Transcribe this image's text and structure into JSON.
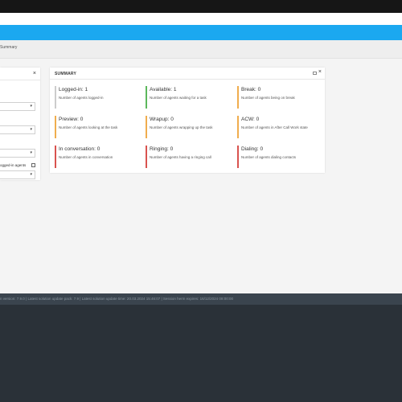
{
  "breadcrumb": {
    "current": "Summary"
  },
  "filter_panel": {
    "close_label": "×",
    "checkbox_label": "ogged-in agents"
  },
  "summary": {
    "title": "SUMMARY",
    "close_label": "×",
    "cards": [
      {
        "label": "Logged-in:",
        "value": "1",
        "description": "Number of agents logged-in",
        "color": "#cccccc"
      },
      {
        "label": "Available:",
        "value": "1",
        "description": "Number of agents waiting for a task",
        "color": "#5cb85c"
      },
      {
        "label": "Break:",
        "value": "0",
        "description": "Number of agents being on break",
        "color": "#f0ad4e"
      },
      {
        "label": "Preview:",
        "value": "0",
        "description": "Number of agents looking at the task",
        "color": "#f0ad4e"
      },
      {
        "label": "Wrapup:",
        "value": "0",
        "description": "Number of agents wrapping up the task",
        "color": "#f0ad4e"
      },
      {
        "label": "ACW:",
        "value": "0",
        "description": "Number of agents in After Call Work state",
        "color": "#f0ad4e"
      },
      {
        "label": "In conversation:",
        "value": "0",
        "description": "Number of agents in conversation",
        "color": "#d9534f"
      },
      {
        "label": "Ringing:",
        "value": "0",
        "description": "Number of agents having a ringing call",
        "color": "#d9534f"
      },
      {
        "label": "Dialing:",
        "value": "0",
        "description": "Number of agents dialing contacts",
        "color": "#d9534f"
      }
    ]
  },
  "status_bar": {
    "text": "n version: 7.9.0 | Latest solution update pack: 7.9 | Latest solution update time: 20.03.2024 15:46:07 | Session herm expires: 16/12/2024 08:00:00"
  },
  "colors": {
    "accent_bar": "#1ba8f0",
    "page_bg": "#f4f4f4",
    "footer_bg": "#2a3138"
  }
}
